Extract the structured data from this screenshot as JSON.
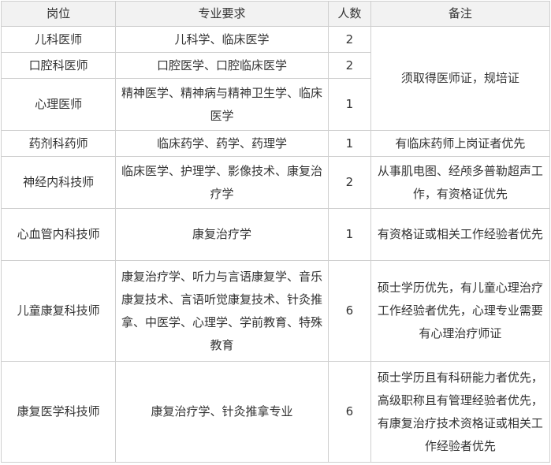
{
  "header": [
    "岗位",
    "专业要求",
    "人数",
    "备注"
  ],
  "rows": [
    {
      "position": "儿科医师",
      "major": "儿科学、临床医学",
      "count": "2"
    },
    {
      "position": "口腔科医师",
      "major": "口腔医学、口腔临床医学",
      "count": "2"
    },
    {
      "position": "心理医师",
      "major": "精神医学、精神病与精神卫生学、临床医学",
      "count": "1"
    },
    {
      "position": "药剂科药师",
      "major": "临床药学、药学、药理学",
      "count": "1",
      "note": "有临床药师上岗证者优先"
    },
    {
      "position": "神经内科技师",
      "major": "临床医学、护理学、影像技术、康复治疗学",
      "count": "2",
      "note": "从事肌电图、经颅多普勒超声工作，有资格证优先"
    },
    {
      "position": "心血管内科技师",
      "major": "康复治疗学",
      "count": "1",
      "note": "有资格证或相关工作经验者优先"
    },
    {
      "position": "儿童康复科技师",
      "major": "康复治疗学、听力与言语康复学、音乐康复技术、言语听觉康复技术、针灸推拿、中医学、心理学、学前教育、特殊教育",
      "count": "6",
      "note": "硕士学历优先，有儿童心理治疗工作经验者优先，心理专业需要有心理治疗师证"
    },
    {
      "position": "康复医学科技师",
      "major": "康复治疗学、针灸推拿专业",
      "count": "6",
      "note": "硕士学历且有科研能力者优先，高级职称且有管理经验者优先，有康复治疗技术资格证或相关工作经验者优先"
    }
  ],
  "merged_note": "须取得医师证，规培证"
}
